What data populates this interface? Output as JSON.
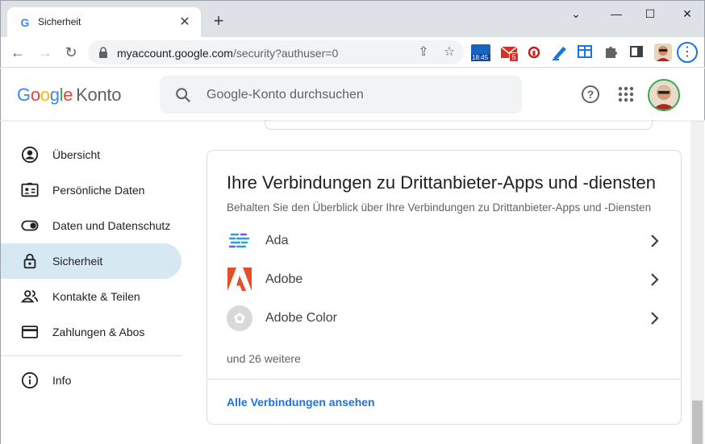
{
  "browser": {
    "tab_title": "Sicherheit",
    "tab_favicon": "G",
    "url_host": "myaccount.google.com",
    "url_path": "/security?authuser=0",
    "ext_badge_time": "18:45",
    "ext_mail_badge": "5"
  },
  "header": {
    "logo_letters": [
      "G",
      "o",
      "o",
      "g",
      "l",
      "e"
    ],
    "logo_suffix": "Konto",
    "search_placeholder": "Google-Konto durchsuchen"
  },
  "sidebar": {
    "items": [
      {
        "label": "Übersicht",
        "icon": "account-circle-icon"
      },
      {
        "label": "Persönliche Daten",
        "icon": "id-card-icon"
      },
      {
        "label": "Daten und Datenschutz",
        "icon": "toggle-icon"
      },
      {
        "label": "Sicherheit",
        "icon": "lock-icon",
        "active": true
      },
      {
        "label": "Kontakte & Teilen",
        "icon": "people-icon"
      },
      {
        "label": "Zahlungen & Abos",
        "icon": "credit-card-icon"
      },
      {
        "label": "Info",
        "icon": "info-icon"
      }
    ]
  },
  "card": {
    "title": "Ihre Verbindungen zu Drittanbieter-Apps und -diensten",
    "subtitle": "Behalten Sie den Überblick über Ihre Verbindungen zu Drittanbieter-Apps und -Diensten",
    "apps": [
      {
        "name": "Ada",
        "icon": "ada-logo-icon"
      },
      {
        "name": "Adobe",
        "icon": "adobe-logo-icon"
      },
      {
        "name": "Adobe Color",
        "icon": "adobe-color-logo-icon"
      }
    ],
    "more_text": "und 26 weitere",
    "all_link": "Alle Verbindungen ansehen"
  },
  "colors": {
    "accent": "#1a73e8",
    "active_nav": "#d6e8f1",
    "adobe_red": "#e34f26"
  }
}
